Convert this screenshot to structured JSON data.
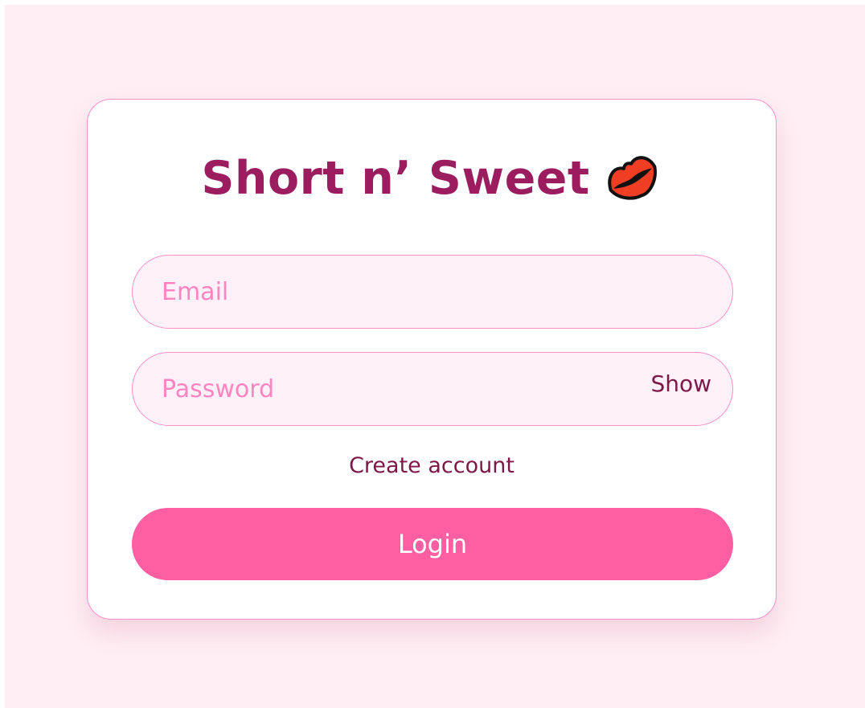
{
  "app": {
    "title": "Short n’ Sweet"
  },
  "icons": {
    "title_icon": "lips-icon"
  },
  "form": {
    "email": {
      "placeholder": "Email",
      "value": ""
    },
    "password": {
      "placeholder": "Password",
      "value": "",
      "toggle_label": "Show"
    },
    "create_account_label": "Create account",
    "login_label": "Login"
  },
  "colors": {
    "background": "#ffeef4",
    "card": "#ffffff",
    "accent": "#ff5ea2",
    "border": "#ff8fc8",
    "title": "#9b1d5f",
    "field_bg": "#fff1f7",
    "placeholder": "#ff85c2"
  }
}
